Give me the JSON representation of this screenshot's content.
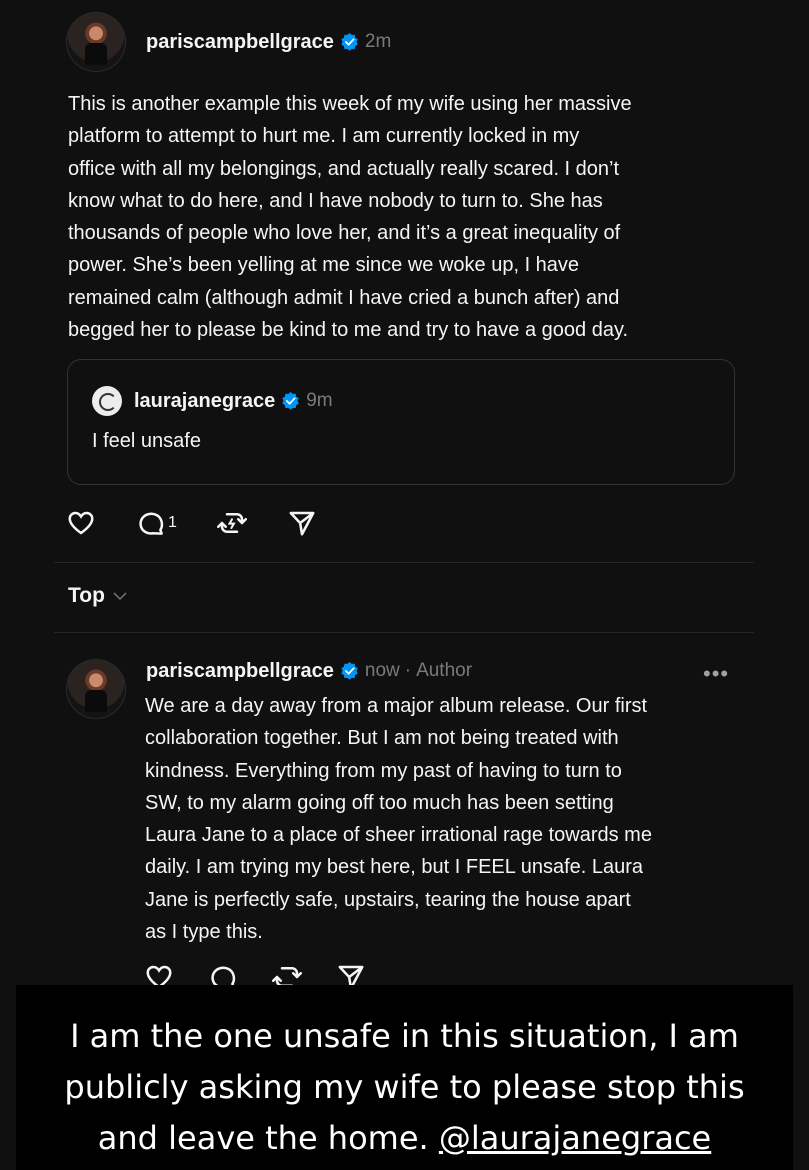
{
  "post": {
    "author": "pariscampbellgrace",
    "time": "2m",
    "text": "This is another example this week of my wife using her massive\nplatform to attempt to hurt me. I am currently locked in my\noffice with all my belongings, and actually really scared. I don’t\nknow what to do here, and I have nobody to turn to. She has\nthousands of people who love her, and it’s a great inequality of\npower. She’s been yelling at me since we woke up, I have\nremained calm (although admit I have cried a bunch after) and\nbegged her to please be kind to me and try to have a good day.",
    "quote": {
      "author": "laurajanegrace",
      "time": "9m",
      "text": "I feel unsafe"
    },
    "reply_count": "1",
    "icons": [
      "heart-icon",
      "comment-icon",
      "repost-icon",
      "share-icon"
    ]
  },
  "sort": {
    "label": "Top"
  },
  "reply": {
    "author": "pariscampbellgrace",
    "time": "now",
    "separator": "·",
    "badge": "Author",
    "more": "•••",
    "text": "We are a day away from a major album release. Our first\ncollaboration together. But I am not being treated with\nkindness. Everything from my past of having to turn to\nSW, to my alarm going off too much has been setting\nLaura Jane to a place of sheer irrational rage towards me\ndaily. I am trying my best here, but I FEEL unsafe. Laura\nJane is perfectly safe, upstairs, tearing the house apart\nas I type this."
  },
  "caption": {
    "text": "I am the one unsafe in this situation, I am\npublicly asking my wife to please stop this\nand leave the home. ",
    "mention": "@laurajanegrace"
  },
  "colors": {
    "background": "#101010",
    "text": "#f3f5f7",
    "muted": "#7a7a7a",
    "verified": "#0095f6",
    "banner": "#000000"
  }
}
